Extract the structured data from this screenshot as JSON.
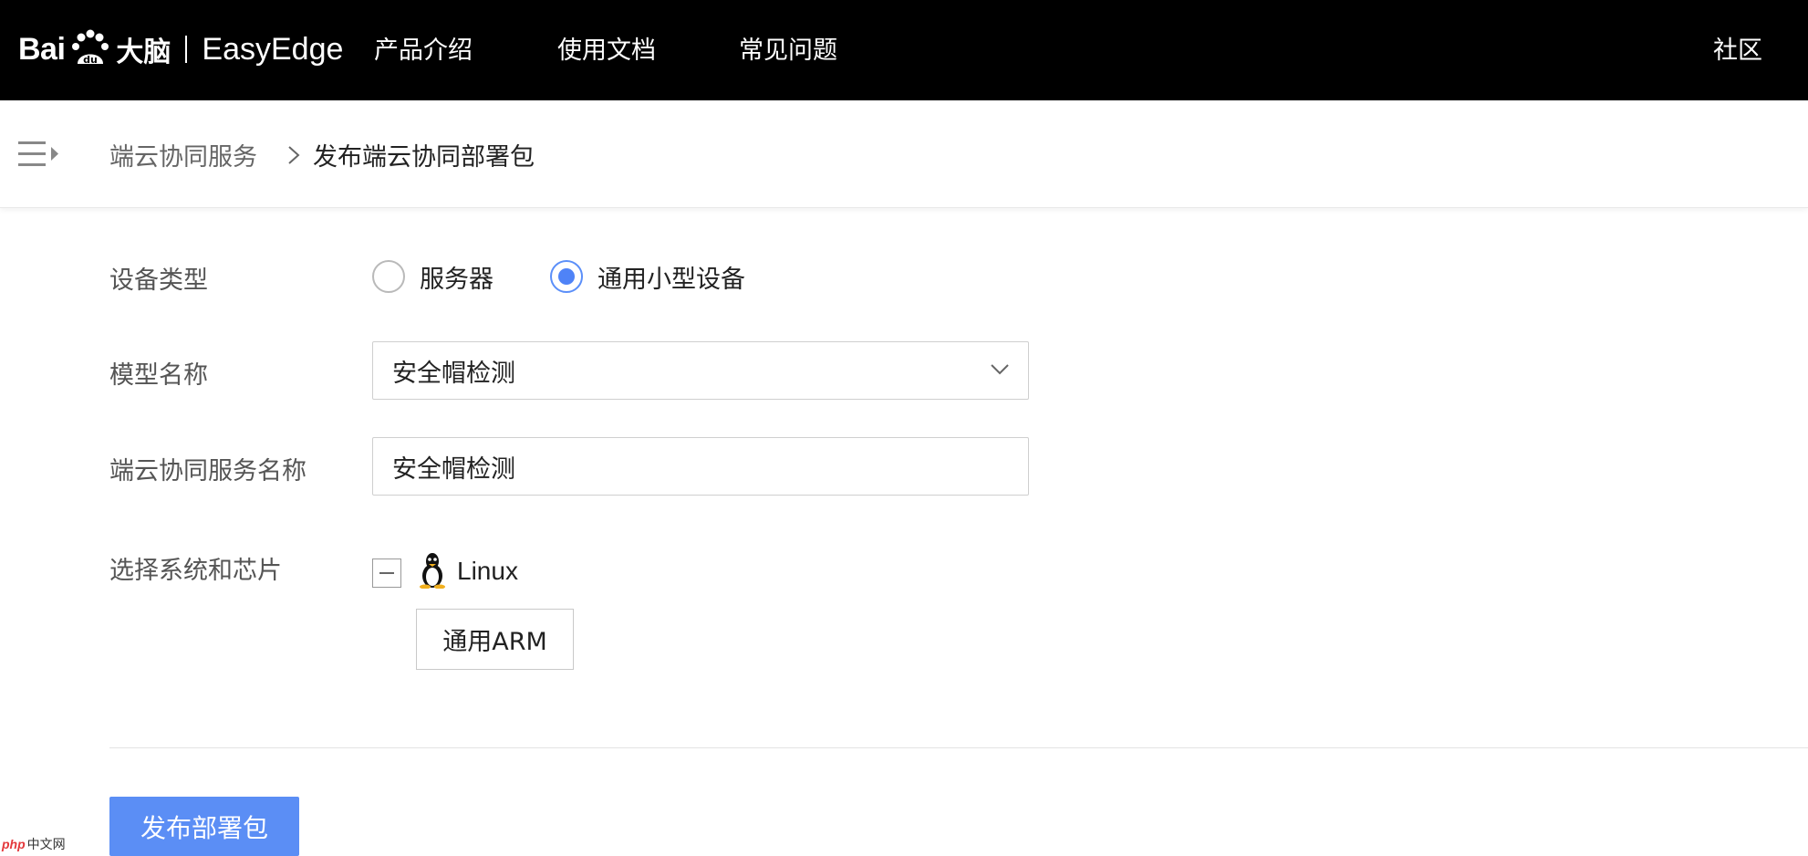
{
  "header": {
    "logo": {
      "brand": "Bai",
      "brand_tail": "",
      "cn": "大脑",
      "product": "EasyEdge"
    },
    "nav": [
      "产品介绍",
      "使用文档",
      "常见问题"
    ],
    "nav_right": "社区"
  },
  "breadcrumb": {
    "parent": "端云协同服务",
    "current": "发布端云协同部署包"
  },
  "form": {
    "device_type": {
      "label": "设备类型",
      "options": [
        "服务器",
        "通用小型设备"
      ],
      "selected": "通用小型设备"
    },
    "model_name": {
      "label": "模型名称",
      "value": "安全帽检测"
    },
    "service_name": {
      "label": "端云协同服务名称",
      "value": "安全帽检测"
    },
    "system_chip": {
      "label": "选择系统和芯片",
      "os": "Linux",
      "chips": [
        "通用ARM"
      ]
    }
  },
  "actions": {
    "publish": "发布部署包"
  },
  "watermark": {
    "php": "php",
    "cn": "中文网"
  },
  "colors": {
    "primary": "#5b8ef5",
    "topbar": "#000000",
    "radio_active": "#4f83f7"
  }
}
